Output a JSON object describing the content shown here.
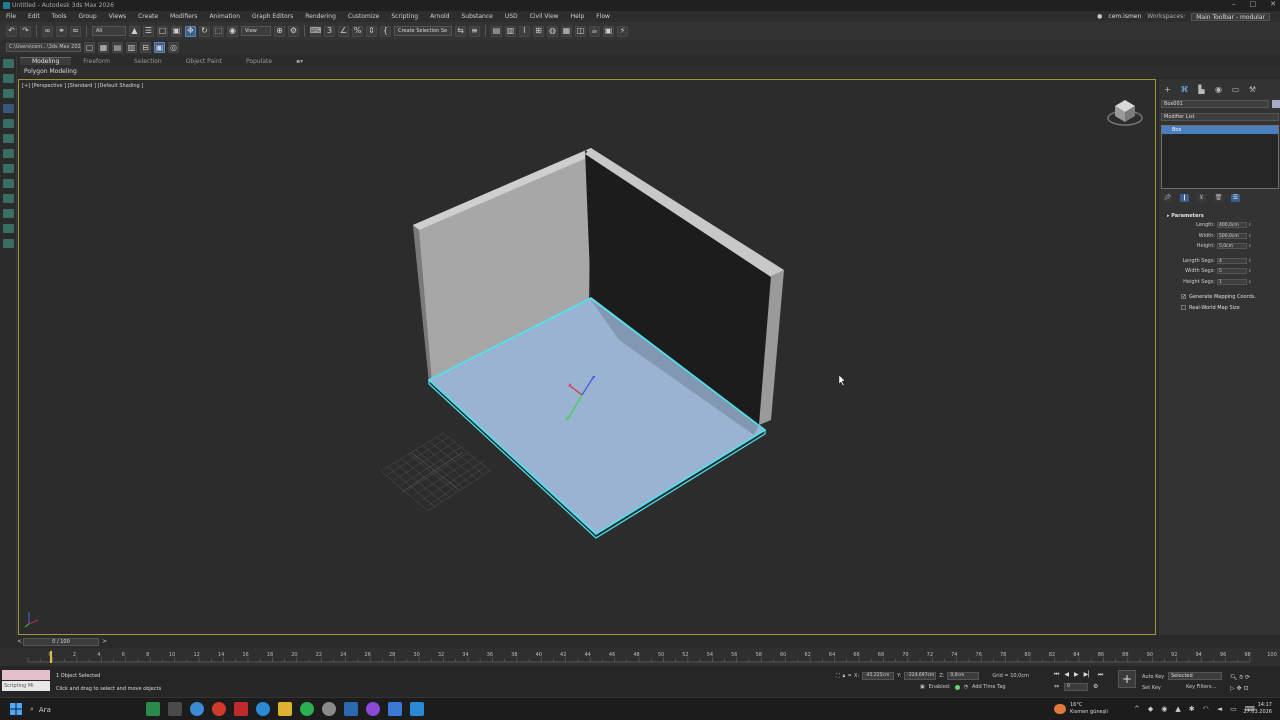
{
  "window": {
    "title": "Untitled - Autodesk 3ds Max 2026",
    "controls": [
      "–",
      "□",
      "✕"
    ]
  },
  "menu": {
    "items": [
      "File",
      "Edit",
      "Tools",
      "Group",
      "Views",
      "Create",
      "Modifiers",
      "Animation",
      "Graph Editors",
      "Rendering",
      "Customize",
      "Scripting",
      "Arnold",
      "Substance",
      "USD",
      "Civil View",
      "Help",
      "Flow"
    ],
    "user": "cem.ismen",
    "workspaces_label": "Workspaces:",
    "workspace_value": "Main Toolbar - modular"
  },
  "toolbar": {
    "selection_filter": "All",
    "ref_coord": "View",
    "selection_set": "Create Selection Se"
  },
  "toolbar2": {
    "project_path": "C:\\Users\\cem...\\3ds Max 2026"
  },
  "ribbon": {
    "tabs": [
      "Modeling",
      "Freeform",
      "Selection",
      "Object Paint",
      "Populate"
    ],
    "active_tab": "Modeling",
    "sub_label": "Polygon Modeling"
  },
  "viewport": {
    "label": "[+] [Perspective ] [Standard ] [Default Shading ]",
    "colors": {
      "selection_outline": "#49e6f2",
      "floor_fill": "#9bb3d2",
      "wall_light": "#a9a9a9",
      "wall_dark": "#1c1c1c",
      "background": "#2c2c2c"
    }
  },
  "command_panel": {
    "tab_icons": [
      "create-icon",
      "modify-icon",
      "hierarchy-icon",
      "motion-icon",
      "display-icon",
      "utilities-icon"
    ],
    "object_name": "Box001",
    "object_color": "#a8a9c9",
    "modifier_list_label": "Modifier List",
    "stack_items": [
      "Box"
    ],
    "parameters_title": "Parameters",
    "params": [
      {
        "label": "Length:",
        "value": "400,0cm"
      },
      {
        "label": "Width:",
        "value": "500,0cm"
      },
      {
        "label": "Height:",
        "value": "5,0cm"
      }
    ],
    "segs": [
      {
        "label": "Length Segs:",
        "value": "4"
      },
      {
        "label": "Width Segs:",
        "value": "5"
      },
      {
        "label": "Height Segs:",
        "value": "1"
      }
    ],
    "checks": [
      {
        "label": "Generate Mapping Coords.",
        "checked": true
      },
      {
        "label": "Real-World Map Size",
        "checked": false
      }
    ]
  },
  "timeline": {
    "slider_label": "0 / 100",
    "ticks": [
      "0",
      "2",
      "4",
      "6",
      "8",
      "10",
      "12",
      "14",
      "16",
      "18",
      "20",
      "22",
      "24",
      "26",
      "28",
      "30",
      "32",
      "34",
      "36",
      "38",
      "40",
      "42",
      "44",
      "46",
      "48",
      "50",
      "52",
      "54",
      "56",
      "58",
      "60",
      "62",
      "64",
      "66",
      "68",
      "70",
      "72",
      "74",
      "76",
      "78",
      "80",
      "82",
      "84",
      "86",
      "88",
      "90",
      "92",
      "94",
      "96",
      "98",
      "100"
    ]
  },
  "status": {
    "maxscript_label": "Scripting Mi",
    "selection_text": "1 Object Selected",
    "prompt_text": "Click and drag to select and move objects",
    "x_label": "X:",
    "x_value": "-45,225cm",
    "y_label": "Y:",
    "y_value": "-224,697cm",
    "z_label": "Z:",
    "z_value": "0,0cm",
    "grid_text": "Grid = 10,0cm",
    "enabled_label": "Enabled:",
    "add_time_tag": "Add Time Tag",
    "auto_key": "Auto Key",
    "set_key": "Set Key",
    "key_mode": "Selected",
    "key_filters": "Key Filters...",
    "frame_value": "0"
  },
  "taskbar": {
    "search_placeholder": "Ara",
    "weather_temp": "16°C",
    "weather_desc": "Kısmen güneşli",
    "time": "14:17",
    "date": "27.03.2026",
    "app_colors": [
      "#2a8a4a",
      "#4a4a4a",
      "#3a8ad6",
      "#d03a2a",
      "#c02a2a",
      "#2a8ad6",
      "#e0b030",
      "#2ab050",
      "#8a8a8a",
      "#2a6ab0",
      "#8a4ad6",
      "#3a7ad6",
      "#2a8ad6"
    ]
  }
}
